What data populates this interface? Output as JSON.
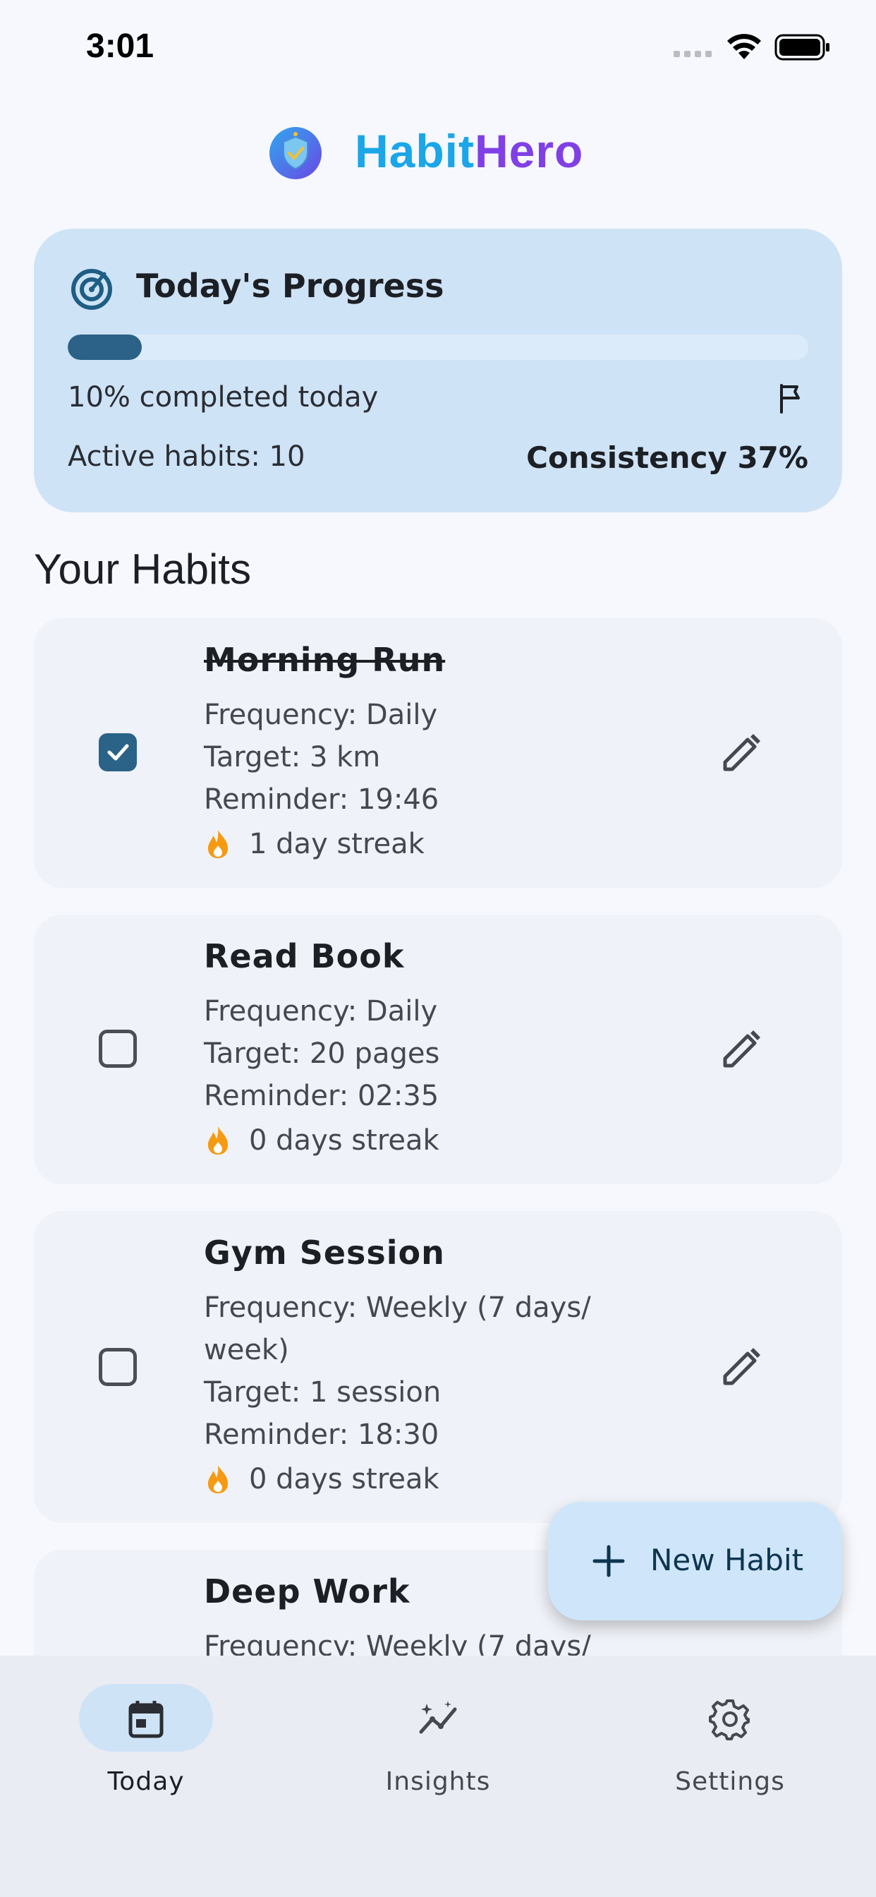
{
  "status_bar": {
    "time": "3:01"
  },
  "header": {
    "brand_part1": "Habit",
    "brand_part2": "Hero",
    "logo_icon": "shield-check-icon"
  },
  "progress_card": {
    "title": "Today's Progress",
    "progress_fraction": 0.1,
    "completed_text": "10% completed today",
    "active_habits": "Active habits: 10",
    "consistency": "Consistency 37%"
  },
  "section_title": "Your Habits",
  "habits": [
    {
      "name": "Morning Run",
      "done": true,
      "frequency": "Frequency: Daily",
      "target": "Target: 3 km",
      "reminder": "Reminder: 19:46",
      "streak": "1 day streak"
    },
    {
      "name": "Read Book",
      "done": false,
      "frequency": "Frequency: Daily",
      "target": "Target: 20 pages",
      "reminder": "Reminder: 02:35",
      "streak": "0 days streak"
    },
    {
      "name": "Gym Session",
      "done": false,
      "frequency": "Frequency: Weekly (7 days/ week)",
      "target": "Target: 1 session",
      "reminder": "Reminder: 18:30",
      "streak": "0 days streak"
    },
    {
      "name": "Deep Work",
      "done": false,
      "frequency": "Frequency: Weekly (7 days/"
    }
  ],
  "fab": {
    "label": "New Habit"
  },
  "nav": {
    "items": [
      {
        "label": "Today",
        "icon": "calendar-icon",
        "active": true
      },
      {
        "label": "Insights",
        "icon": "insights-icon",
        "active": false
      },
      {
        "label": "Settings",
        "icon": "gear-icon",
        "active": false
      }
    ]
  },
  "colors": {
    "brand_blue": "#1aa6e8",
    "brand_purple": "#8040e6",
    "progress_fill": "#2c6188",
    "card_bg": "#cfe3f7",
    "streak_orange": "#f59a12"
  }
}
